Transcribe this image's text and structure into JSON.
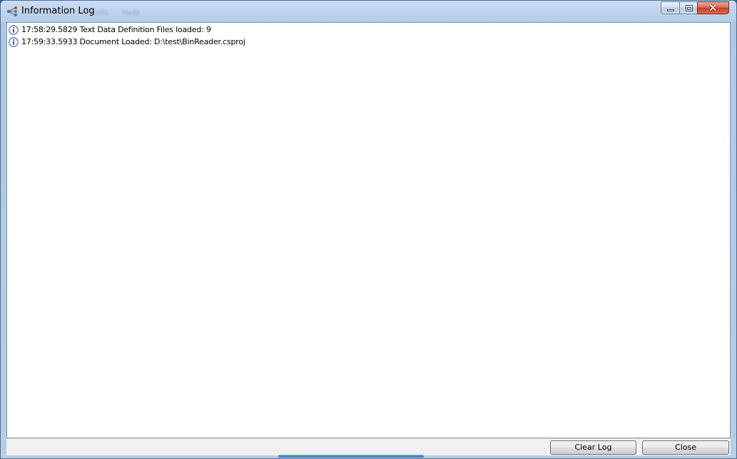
{
  "window": {
    "title": "Information Log",
    "ghost_menu": [
      "Tools",
      "Help"
    ]
  },
  "title_controls": {
    "minimize": "minimize",
    "maximize": "maximize",
    "close_glyph": "✕"
  },
  "log": {
    "entries": [
      {
        "icon": "info-icon",
        "text": "17:58:29.5829 Text Data Definition Files loaded: 9"
      },
      {
        "icon": "info-icon",
        "text": "17:59:33.5933 Document Loaded: D:\\test\\BinReader.csproj"
      }
    ]
  },
  "buttons": {
    "clear_log": "Clear Log",
    "close": "Close"
  },
  "colors": {
    "title_bar": "#c9dcf1",
    "close_button": "#c6402a",
    "info_icon": "#3c66a8",
    "button_border": "#707070"
  }
}
